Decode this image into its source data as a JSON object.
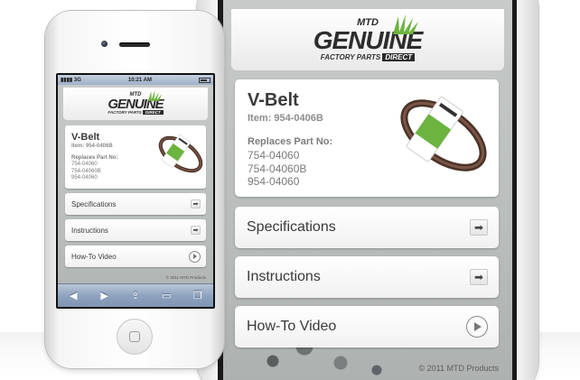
{
  "brand": {
    "logo_top": "MTD",
    "logo_main": "GENUINE",
    "logo_sub": "FACTORY PARTS",
    "logo_direct": "DIRECT",
    "accent_green": "#6cb33f",
    "logo_dark": "#2d2d2d"
  },
  "product": {
    "title": "V-Belt",
    "item": "Item: 954-0406B",
    "replaces_label": "Replaces Part No:",
    "replaces": [
      "754-04060",
      "754-04060B",
      "954-04060"
    ]
  },
  "menu": [
    {
      "label": "Specifications",
      "icon": "arrow-right-icon"
    },
    {
      "label": "Instructions",
      "icon": "arrow-right-icon"
    },
    {
      "label": "How-To Video",
      "icon": "play-icon"
    }
  ],
  "footer": {
    "copyright": "© 2011 MTD Products"
  },
  "status_bar": {
    "carrier": "3G",
    "time": "10:21 AM"
  },
  "toolbar": {
    "back_icon": "back-arrow-icon",
    "forward_icon": "forward-arrow-icon",
    "share_icon": "share-icon",
    "bookmarks_icon": "bookmarks-icon",
    "pages_icon": "pages-icon"
  }
}
